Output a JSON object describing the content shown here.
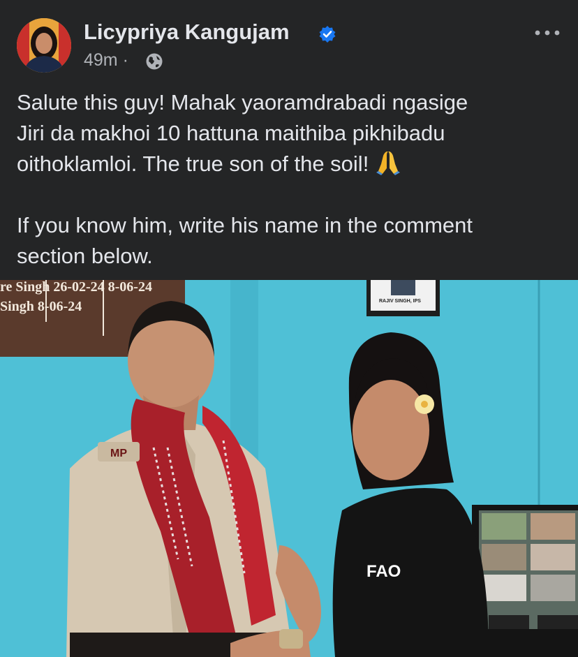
{
  "post": {
    "author": "Licypriya Kangujam",
    "time": "49m",
    "separator": "·",
    "paragraph1_line1": "Salute this guy! Mahak yaoramdrabadi ngasige",
    "paragraph1_line2": "Jiri da makhoi 10 hattuna maithiba pikhibadu",
    "paragraph1_line3": "oithoklamloi. The true son of the soil!",
    "paragraph2_line1": "If you know him, write his name in the comment",
    "paragraph2_line2": "section below."
  },
  "photo": {
    "board_row1": "re Singh 26-02-24 8-06-24",
    "board_row2": "Singh 8-06-24",
    "frame_caption": "RAJIV SINGH, IPS",
    "rank_badge": "MP",
    "shirt_logo": "FAO"
  },
  "colors": {
    "background": "#242526",
    "text": "#e4e6eb",
    "secondary": "#b0b3b8",
    "verified": "#1877f2",
    "wall": "#4fc0d6"
  },
  "icons": [
    "verified-badge-icon",
    "globe-icon",
    "more-options-icon",
    "folded-hands-icon"
  ]
}
